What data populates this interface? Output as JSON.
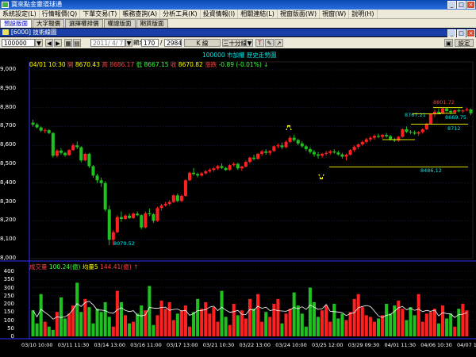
{
  "window": {
    "title": "寶來點金靈環球通"
  },
  "menu": [
    "系統設定(L)",
    "行情報價(Q)",
    "下單交易(T)",
    "帳務查詢(A)",
    "分析工具(K)",
    "投資情報(I)",
    "相關連結(L)",
    "視窗版面(W)",
    "視窗(W)",
    "說明(H)"
  ],
  "tabs": [
    "預設版面",
    "大字報價",
    "選擇權排價",
    "權證版面",
    "期貨版面"
  ],
  "panel": {
    "title": "[6000] 技術線圖"
  },
  "toolbar": {
    "symbol": "100000",
    "date": "2011/ 4/ 7",
    "show_label": "顯示",
    "show_count": "170",
    "total": "2984",
    "kline": "K 線",
    "period": "三十分線",
    "t_btn": "T",
    "settings": "設定"
  },
  "chart_title": "100000 市加權  歷史走勢圖",
  "info": {
    "datetime": "04/01 10:30",
    "open_label": "開",
    "open": "8670.43",
    "high_label": "高",
    "high": "8686.17",
    "low_label": "低",
    "low": "8667.15",
    "close_label": "收",
    "close": "8670.82",
    "change_label": "漲跌",
    "change": "-0.89 (-0.01%)"
  },
  "volume_info": {
    "label": "成交量",
    "value": "100.24(億)",
    "ma_label": "均量5",
    "ma_value": "144.41(億)"
  },
  "annotations": {
    "high": "8801.72",
    "a": "8669.75",
    "b": "8767.21",
    "c": "8712",
    "d": "8486.12",
    "low": "8070.52"
  },
  "colors": {
    "up": "#ff2020",
    "down": "#20c020",
    "ma": "#ffffff",
    "hline": "#e0e000",
    "axis": "#3030ff"
  },
  "chart_data": {
    "type": "candlestick",
    "price_axis": {
      "ticks": [
        "9,000",
        "8,900",
        "8,800",
        "8,700",
        "8,600",
        "8,500",
        "8,400",
        "8,300",
        "8,200",
        "8,100",
        "8,000"
      ],
      "range": [
        8000,
        9000
      ]
    },
    "volume_axis": {
      "ticks": [
        "400",
        "350",
        "300",
        "250",
        "200",
        "150",
        "100",
        "50",
        "0"
      ],
      "range": [
        0,
        400
      ]
    },
    "x_labels": [
      "03/10 10:00",
      "03/11 11:30",
      "03/14 13:00",
      "03/16 11:00",
      "03/17 13:00",
      "03/21 10:30",
      "03/22 13:00",
      "03/24 10:00",
      "03/25 12:00",
      "03/29 09:30",
      "04/01 11:30",
      "04/06 10:30",
      "04/07 13:00"
    ],
    "candles": [
      [
        8720,
        8735,
        8700,
        8710
      ],
      [
        8710,
        8718,
        8690,
        8695
      ],
      [
        8695,
        8700,
        8670,
        8678
      ],
      [
        8678,
        8690,
        8665,
        8680
      ],
      [
        8680,
        8686,
        8660,
        8665
      ],
      [
        8665,
        8670,
        8535,
        8545
      ],
      [
        8545,
        8580,
        8535,
        8572
      ],
      [
        8572,
        8585,
        8550,
        8560
      ],
      [
        8560,
        8565,
        8540,
        8548
      ],
      [
        8548,
        8580,
        8545,
        8575
      ],
      [
        8575,
        8610,
        8570,
        8600
      ],
      [
        8600,
        8620,
        8580,
        8590
      ],
      [
        8590,
        8595,
        8510,
        8520
      ],
      [
        8520,
        8560,
        8515,
        8555
      ],
      [
        8555,
        8560,
        8480,
        8490
      ],
      [
        8490,
        8495,
        8430,
        8440
      ],
      [
        8440,
        8450,
        8400,
        8415
      ],
      [
        8415,
        8430,
        8380,
        8400
      ],
      [
        8400,
        8410,
        8250,
        8260
      ],
      [
        8260,
        8280,
        8071,
        8100
      ],
      [
        8100,
        8150,
        8071,
        8140
      ],
      [
        8140,
        8230,
        8135,
        8220
      ],
      [
        8220,
        8250,
        8195,
        8210
      ],
      [
        8210,
        8235,
        8205,
        8228
      ],
      [
        8228,
        8240,
        8210,
        8215
      ],
      [
        8215,
        8245,
        8210,
        8238
      ],
      [
        8238,
        8250,
        8225,
        8230
      ],
      [
        8230,
        8235,
        8155,
        8165
      ],
      [
        8165,
        8250,
        8160,
        8240
      ],
      [
        8240,
        8265,
        8225,
        8235
      ],
      [
        8235,
        8240,
        8190,
        8200
      ],
      [
        8200,
        8275,
        8195,
        8268
      ],
      [
        8268,
        8290,
        8255,
        8282
      ],
      [
        8282,
        8300,
        8275,
        8290
      ],
      [
        8290,
        8310,
        8280,
        8300
      ],
      [
        8300,
        8340,
        8295,
        8335
      ],
      [
        8335,
        8345,
        8300,
        8305
      ],
      [
        8305,
        8340,
        8300,
        8332
      ],
      [
        8332,
        8420,
        8328,
        8415
      ],
      [
        8415,
        8460,
        8410,
        8455
      ],
      [
        8455,
        8480,
        8440,
        8448
      ],
      [
        8448,
        8455,
        8430,
        8440
      ],
      [
        8440,
        8458,
        8435,
        8452
      ],
      [
        8452,
        8470,
        8445,
        8462
      ],
      [
        8462,
        8478,
        8455,
        8470
      ],
      [
        8470,
        8485,
        8460,
        8478
      ],
      [
        8478,
        8495,
        8470,
        8490
      ],
      [
        8490,
        8505,
        8475,
        8480
      ],
      [
        8480,
        8485,
        8465,
        8470
      ],
      [
        8470,
        8500,
        8465,
        8495
      ],
      [
        8495,
        8510,
        8488,
        8502
      ],
      [
        8502,
        8508,
        8470,
        8478
      ],
      [
        8478,
        8492,
        8465,
        8488
      ],
      [
        8488,
        8520,
        8482,
        8512
      ],
      [
        8512,
        8540,
        8505,
        8535
      ],
      [
        8535,
        8550,
        8520,
        8528
      ],
      [
        8528,
        8560,
        8525,
        8555
      ],
      [
        8555,
        8575,
        8545,
        8568
      ],
      [
        8568,
        8580,
        8550,
        8560
      ],
      [
        8560,
        8575,
        8548,
        8570
      ],
      [
        8570,
        8600,
        8565,
        8595
      ],
      [
        8595,
        8610,
        8585,
        8600
      ],
      [
        8600,
        8615,
        8580,
        8590
      ],
      [
        8590,
        8625,
        8585,
        8618
      ],
      [
        8618,
        8650,
        8612,
        8640
      ],
      [
        8640,
        8655,
        8620,
        8628
      ],
      [
        8628,
        8635,
        8600,
        8610
      ],
      [
        8610,
        8620,
        8588,
        8595
      ],
      [
        8595,
        8602,
        8570,
        8580
      ],
      [
        8580,
        8590,
        8555,
        8565
      ],
      [
        8565,
        8575,
        8540,
        8552
      ],
      [
        8552,
        8565,
        8530,
        8545
      ],
      [
        8545,
        8560,
        8535,
        8555
      ],
      [
        8555,
        8570,
        8545,
        8560
      ],
      [
        8560,
        8575,
        8550,
        8568
      ],
      [
        8568,
        8580,
        8555,
        8562
      ],
      [
        8562,
        8572,
        8545,
        8552
      ],
      [
        8552,
        8560,
        8530,
        8540
      ],
      [
        8540,
        8555,
        8520,
        8550
      ],
      [
        8550,
        8580,
        8545,
        8575
      ],
      [
        8575,
        8600,
        8565,
        8592
      ],
      [
        8592,
        8610,
        8580,
        8605
      ],
      [
        8605,
        8625,
        8598,
        8618
      ],
      [
        8618,
        8640,
        8610,
        8632
      ],
      [
        8632,
        8648,
        8620,
        8640
      ],
      [
        8640,
        8658,
        8630,
        8650
      ],
      [
        8650,
        8662,
        8638,
        8645
      ],
      [
        8645,
        8660,
        8635,
        8655
      ],
      [
        8655,
        8665,
        8640,
        8648
      ],
      [
        8648,
        8655,
        8625,
        8632
      ],
      [
        8632,
        8640,
        8618,
        8625
      ],
      [
        8625,
        8650,
        8620,
        8645
      ],
      [
        8645,
        8690,
        8640,
        8685
      ],
      [
        8685,
        8700,
        8665,
        8672
      ],
      [
        8672,
        8680,
        8660,
        8668
      ],
      [
        8668,
        8678,
        8655,
        8662
      ],
      [
        8662,
        8675,
        8650,
        8670
      ],
      [
        8670,
        8690,
        8662,
        8685
      ],
      [
        8685,
        8720,
        8680,
        8715
      ],
      [
        8715,
        8770,
        8710,
        8765
      ],
      [
        8765,
        8790,
        8750,
        8778
      ],
      [
        8778,
        8795,
        8765,
        8770
      ],
      [
        8770,
        8800,
        8765,
        8795
      ],
      [
        8795,
        8802,
        8775,
        8782
      ],
      [
        8782,
        8790,
        8765,
        8775
      ],
      [
        8775,
        8790,
        8770,
        8786
      ],
      [
        8786,
        8795,
        8775,
        8780
      ],
      [
        8780,
        8790,
        8770,
        8785
      ],
      [
        8785,
        8800,
        8780,
        8790
      ],
      [
        8790,
        8795,
        8760,
        8770
      ]
    ],
    "volumes": [
      160,
      80,
      260,
      90,
      60,
      40,
      150,
      240,
      110,
      140,
      190,
      330,
      150,
      230,
      180,
      80,
      170,
      150,
      210,
      120,
      60,
      280,
      210,
      130,
      80,
      90,
      140,
      190,
      160,
      310,
      70,
      130,
      220,
      170,
      210,
      100,
      140,
      160,
      190,
      60,
      150,
      230,
      170,
      210,
      140,
      180,
      90,
      280,
      120,
      70,
      200,
      130,
      160,
      110,
      230,
      170,
      260,
      90,
      150,
      120,
      200,
      230,
      80,
      140,
      170,
      270,
      190,
      140,
      60,
      300,
      210,
      120,
      160,
      190,
      90,
      200,
      110,
      140,
      100,
      150,
      230,
      260,
      180,
      130,
      120,
      90,
      110,
      130,
      200,
      140,
      190,
      220,
      170,
      100,
      180,
      130,
      260,
      90,
      140,
      150,
      170,
      80,
      190,
      110,
      140,
      60,
      170,
      200,
      160
    ]
  }
}
